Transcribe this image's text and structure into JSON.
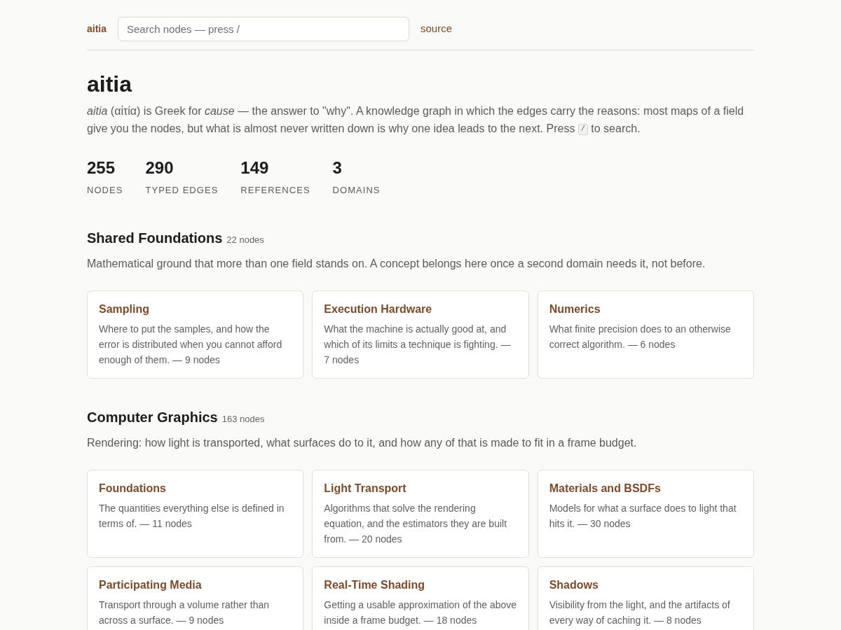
{
  "header": {
    "brand": "aitia",
    "search": {
      "placeholder": "Search nodes — press /"
    },
    "links": [
      "source"
    ]
  },
  "title": "aitia",
  "intro": {
    "text": "*aitia* (αἰτία) is Greek for *cause* — the answer to \"why\". A knowledge graph in which the edges carry the reasons: most maps of a field give you the nodes, but what is almost never written down is why one idea leads to the next. Press",
    "key": "/",
    "text_after": "to search."
  },
  "stats": [
    {
      "value": "255",
      "label": "NODES"
    },
    {
      "value": "290",
      "label": "TYPED EDGES"
    },
    {
      "value": "149",
      "label": "REFERENCES"
    },
    {
      "value": "3",
      "label": "DOMAINS"
    }
  ],
  "sections": [
    {
      "title": "Shared Foundations",
      "count": "22 nodes",
      "description": "Mathematical ground that more than one field stands on. A concept belongs here once a second domain needs it, not before.",
      "cards": [
        {
          "title": "Sampling",
          "description": "Where to put the samples, and how the error is distributed when you cannot afford enough of them. — 9 nodes"
        },
        {
          "title": "Execution Hardware",
          "description": "What the machine is actually good at, and which of its limits a technique is fighting. — 7 nodes"
        },
        {
          "title": "Numerics",
          "description": "What finite precision does to an otherwise correct algorithm. — 6 nodes"
        }
      ]
    },
    {
      "title": "Computer Graphics",
      "count": "163 nodes",
      "description": "Rendering: how light is transported, what surfaces do to it, and how any of that is made to fit in a frame budget.",
      "cards": [
        {
          "title": "Foundations",
          "description": "The quantities everything else is defined in terms of. — 11 nodes"
        },
        {
          "title": "Light Transport",
          "description": "Algorithms that solve the rendering equation, and the estimators they are built from. — 20 nodes"
        },
        {
          "title": "Materials and BSDFs",
          "description": "Models for what a surface does to light that hits it. — 30 nodes"
        },
        {
          "title": "Participating Media",
          "description": "Transport through a volume rather than across a surface. — 9 nodes"
        },
        {
          "title": "Real-Time Shading",
          "description": "Getting a usable approximation of the above inside a frame budget. — 18 nodes"
        },
        {
          "title": "Shadows",
          "description": "Visibility from the light, and the artifacts of every way of caching it. — 8 nodes"
        }
      ]
    }
  ]
}
